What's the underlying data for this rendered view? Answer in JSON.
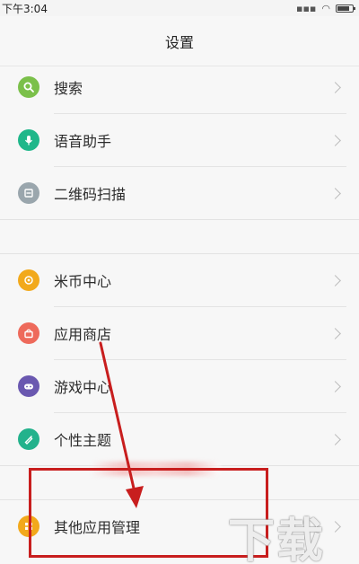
{
  "status": {
    "time": "下午3:04"
  },
  "header": {
    "title": "设置"
  },
  "menu": {
    "search": {
      "label": "搜索",
      "icon": "search-icon",
      "color": "#7bc04a"
    },
    "voice": {
      "label": "语音助手",
      "icon": "microphone-icon",
      "color": "#1fb78a"
    },
    "qr": {
      "label": "二维码扫描",
      "icon": "qr-scan-icon",
      "color": "#9aa6ad"
    },
    "micoin": {
      "label": "米币中心",
      "icon": "coin-icon",
      "color": "#f2a91c"
    },
    "store": {
      "label": "应用商店",
      "icon": "shopping-bag-icon",
      "color": "#ee6a5b"
    },
    "games": {
      "label": "游戏中心",
      "icon": "gamepad-icon",
      "color": "#6a58b0"
    },
    "themes": {
      "label": "个性主题",
      "icon": "theme-brush-icon",
      "color": "#23b28c"
    },
    "other_apps": {
      "label": "其他应用管理",
      "icon": "apps-icon",
      "color": "#f2a91c"
    }
  },
  "watermark": {
    "text": "下载"
  },
  "annotation": {
    "highlight_color": "#c81e1e"
  }
}
